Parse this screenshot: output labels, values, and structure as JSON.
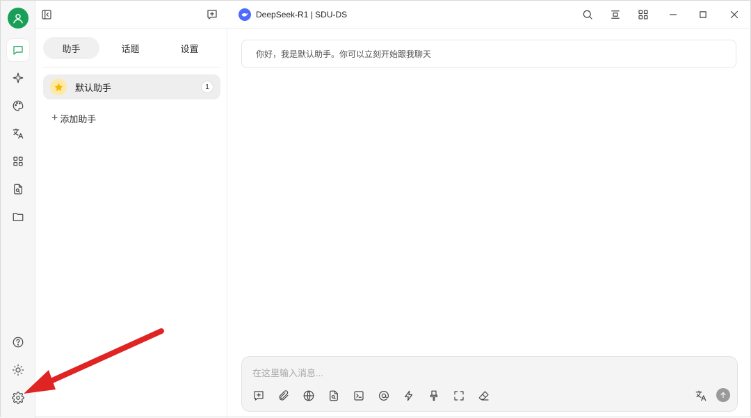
{
  "window": {
    "model_label": "DeepSeek-R1 | SDU-DS",
    "brand_color": "#4d6bfe",
    "accent_color": "#18a058"
  },
  "rail": {
    "items": [
      {
        "name": "chat",
        "icon": "chat-icon",
        "active": true
      },
      {
        "name": "agents",
        "icon": "sparkle-icon"
      },
      {
        "name": "paint",
        "icon": "palette-icon"
      },
      {
        "name": "translate",
        "icon": "translate-icon"
      },
      {
        "name": "apps",
        "icon": "grid-icon"
      },
      {
        "name": "files",
        "icon": "file-search-icon"
      },
      {
        "name": "folder",
        "icon": "folder-icon"
      }
    ],
    "bottom": [
      {
        "name": "help",
        "icon": "help-icon"
      },
      {
        "name": "theme",
        "icon": "sun-icon"
      },
      {
        "name": "settings",
        "icon": "gear-icon"
      }
    ]
  },
  "panel": {
    "tabs": [
      "助手",
      "话题",
      "设置"
    ],
    "active_tab": "助手",
    "assistant": {
      "name": "默认助手",
      "count": "1",
      "icon": "star-emoji"
    },
    "add_label": "添加助手"
  },
  "chat": {
    "greeting": "你好，我是默认助手。你可以立刻开始跟我聊天"
  },
  "composer": {
    "placeholder": "在这里输入消息...",
    "tools": [
      "new-topic-icon",
      "attachment-icon",
      "globe-icon",
      "file-search-icon",
      "terminal-icon",
      "mention-icon",
      "lightning-icon",
      "brush-icon",
      "expand-icon",
      "eraser-icon"
    ]
  },
  "annotation": {
    "color": "#e02424",
    "shape": "arrow pointing to settings"
  }
}
